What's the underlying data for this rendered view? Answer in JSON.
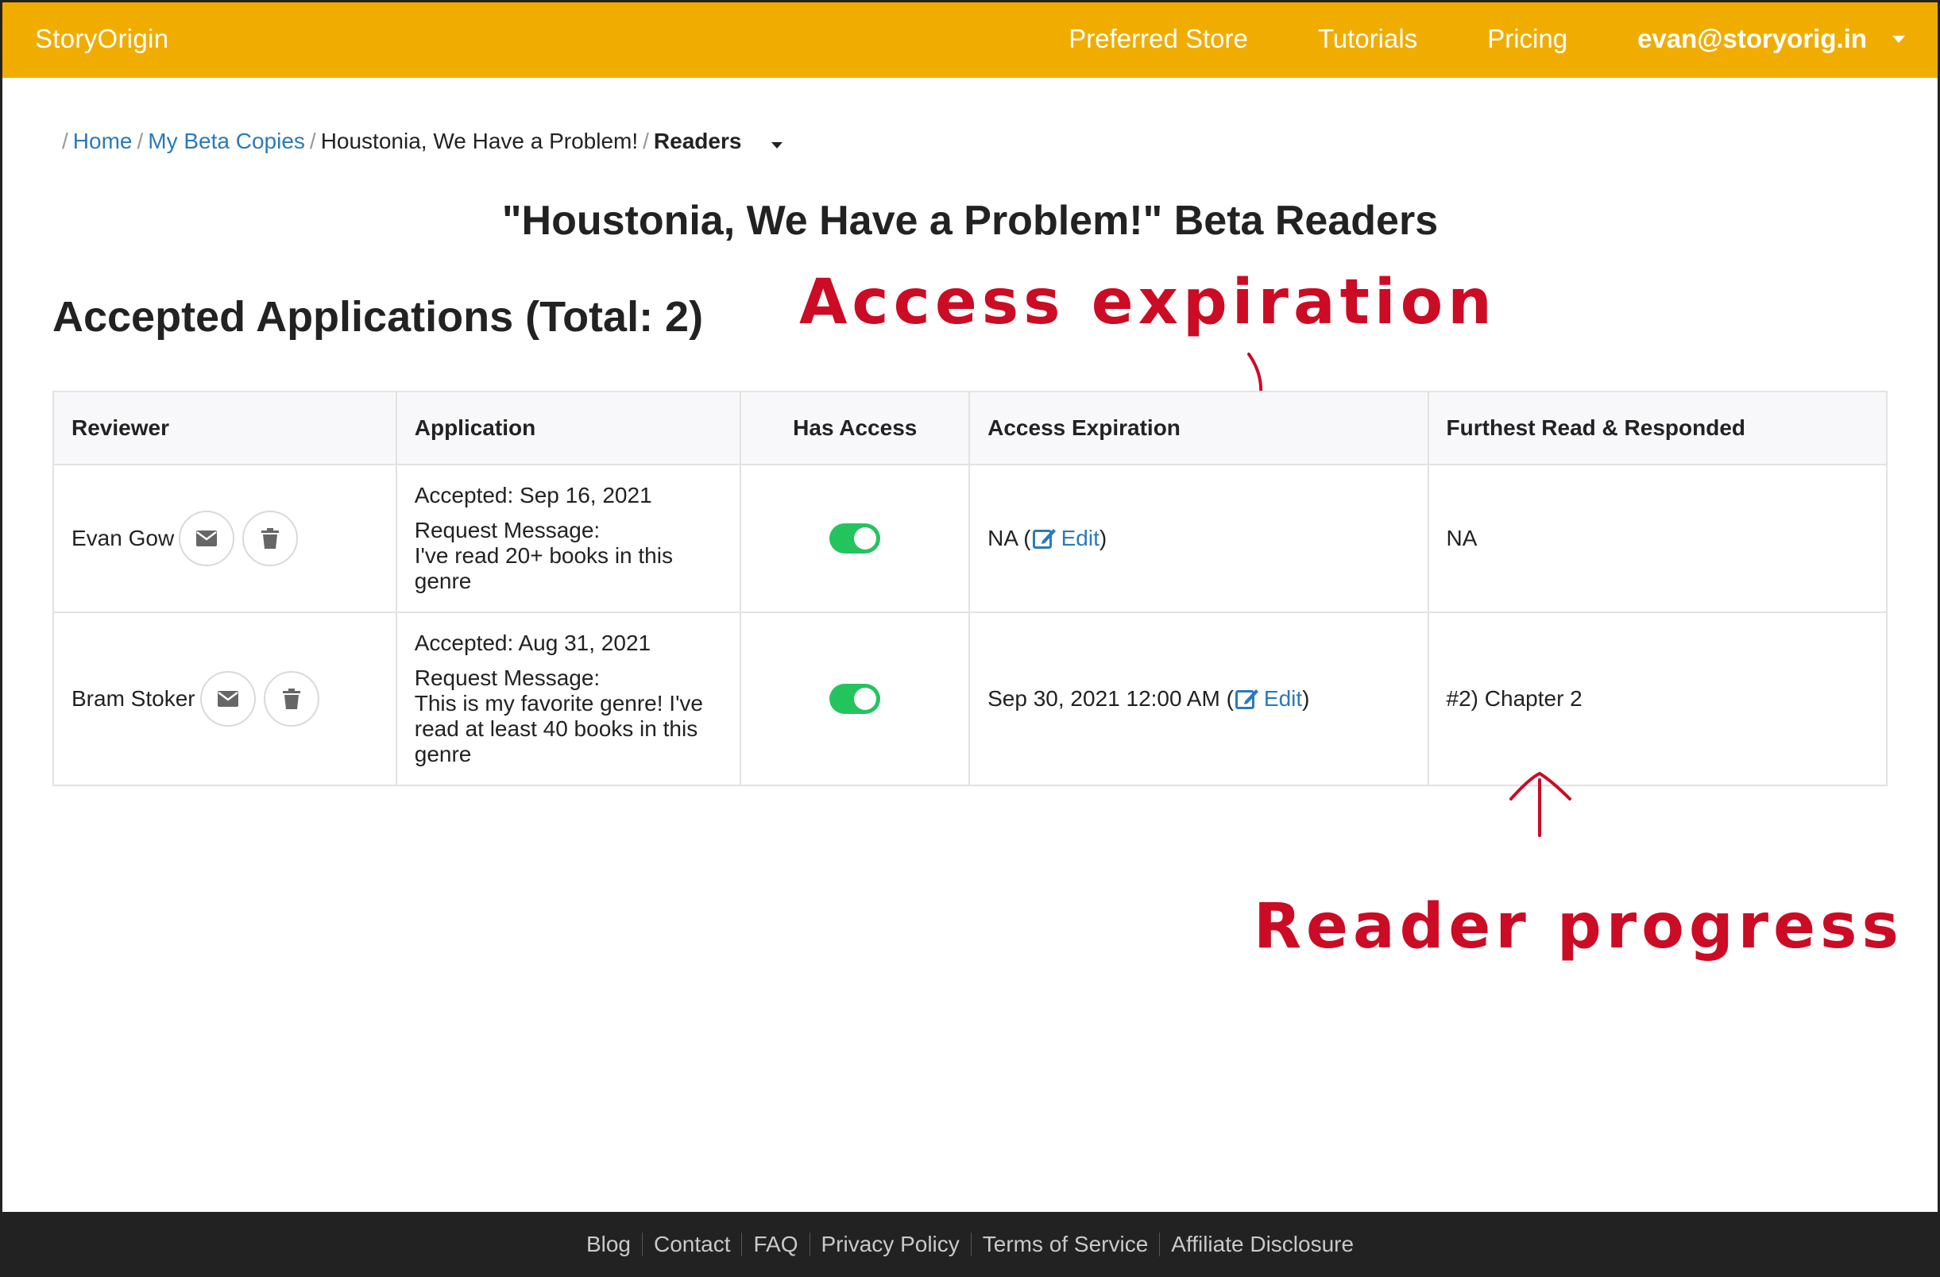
{
  "header": {
    "brand": "StoryOrigin",
    "nav": [
      "Preferred Store",
      "Tutorials",
      "Pricing"
    ],
    "user_email": "evan@storyorig.in"
  },
  "breadcrumb": {
    "home": "Home",
    "beta_copies": "My Beta Copies",
    "book": "Houstonia, We Have a Problem!",
    "current": "Readers"
  },
  "page_title": "\"Houstonia, We Have a Problem!\" Beta Readers",
  "section_title": "Accepted Applications (Total: 2)",
  "table": {
    "columns": [
      "Reviewer",
      "Application",
      "Has Access",
      "Access Expiration",
      "Furthest Read & Responded"
    ],
    "rows": [
      {
        "reviewer": "Evan Gow",
        "accepted": "Accepted: Sep 16, 2021",
        "request_label": "Request Message:",
        "message_lines": [
          "I've read 20+ books in this",
          "genre"
        ],
        "has_access": true,
        "expiration": "NA (",
        "edit_label": "Edit",
        "close_paren": ")",
        "furthest": "NA"
      },
      {
        "reviewer": "Bram Stoker",
        "accepted": "Accepted: Aug 31, 2021",
        "request_label": "Request Message:",
        "message_lines": [
          "This is my favorite genre! I've",
          "read at least 40 books in this",
          "genre"
        ],
        "has_access": true,
        "expiration": "Sep 30, 2021 12:00 AM (",
        "edit_label": "Edit",
        "close_paren": ")",
        "furthest": "#2) Chapter 2"
      }
    ]
  },
  "annotations": {
    "access": "Access expiration",
    "reader": "Reader progress"
  },
  "footer": {
    "links": [
      "Blog",
      "Contact",
      "FAQ",
      "Privacy Policy",
      "Terms of Service",
      "Affiliate Disclosure"
    ]
  },
  "colors": {
    "brand": "#f0ad00",
    "link": "#2a7ab9",
    "toggle_on": "#23c45e",
    "annotation": "#cc0b24",
    "footer": "#222222"
  },
  "icons": [
    "envelope-icon",
    "trash-icon",
    "edit-icon",
    "chevron-down-icon"
  ]
}
